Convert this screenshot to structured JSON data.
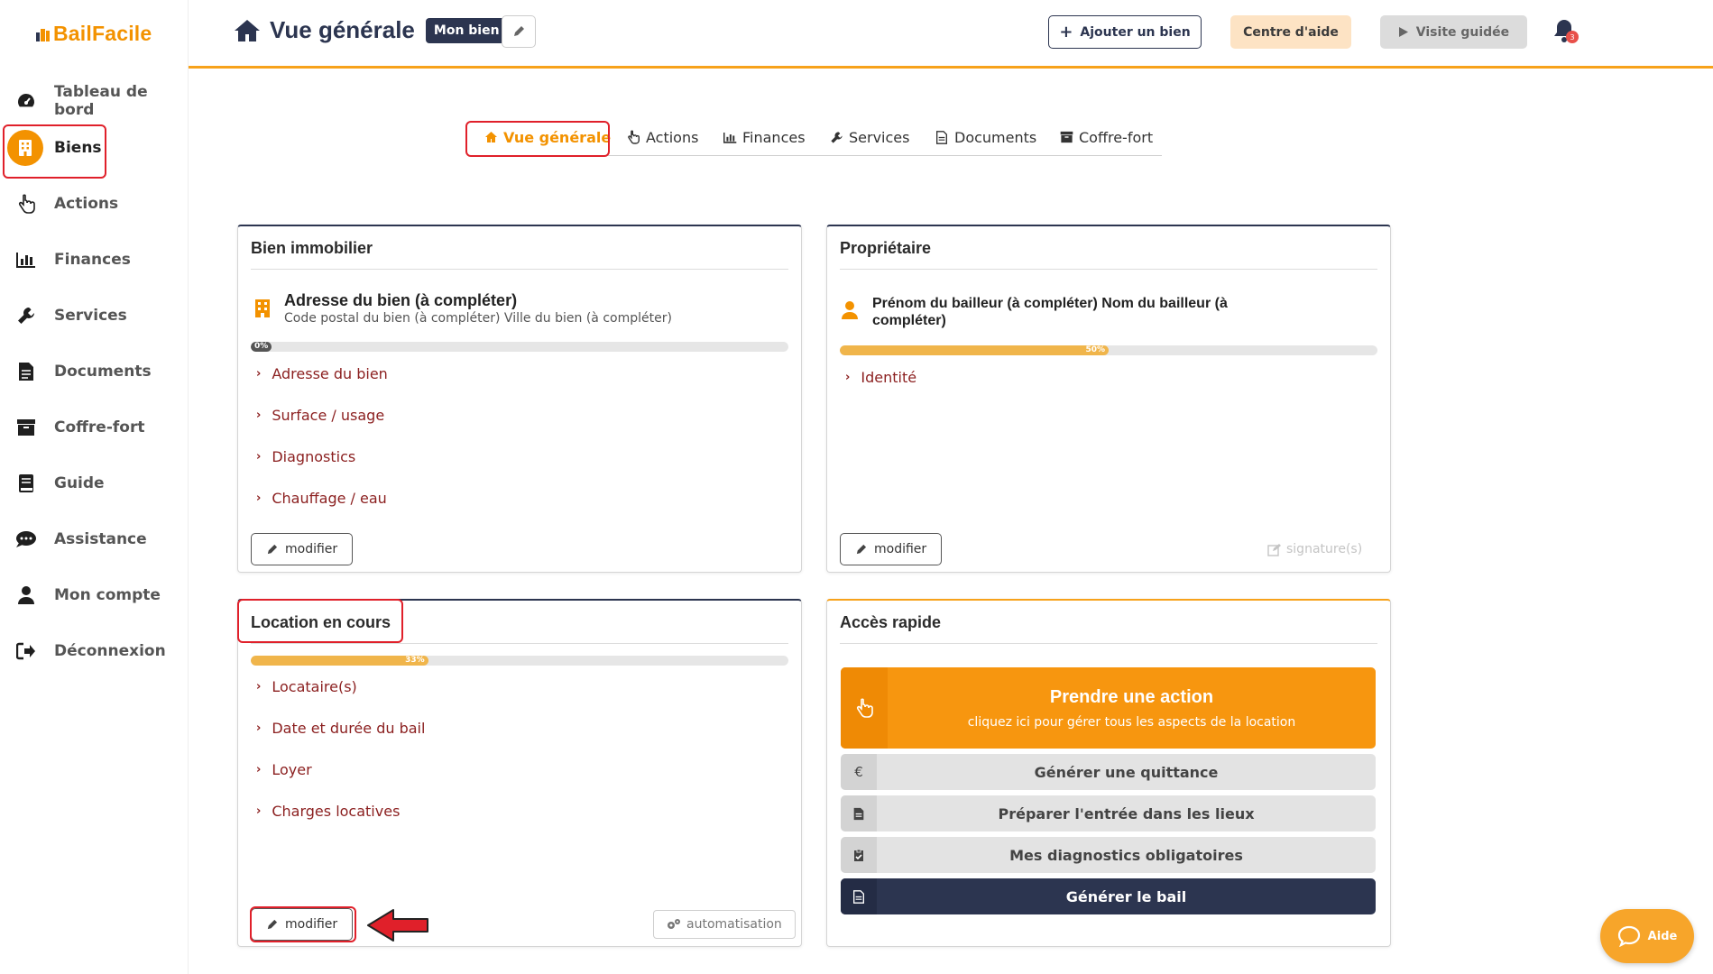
{
  "brand": {
    "name": "BailFacile",
    "color": "#f39200"
  },
  "sidebar": {
    "items": [
      {
        "label": "Tableau de bord",
        "icon": "gauge-icon"
      },
      {
        "label": "Biens",
        "icon": "building-icon",
        "active": true
      },
      {
        "label": "Actions",
        "icon": "hand-pointer-icon"
      },
      {
        "label": "Finances",
        "icon": "chart-icon"
      },
      {
        "label": "Services",
        "icon": "wrench-icon"
      },
      {
        "label": "Documents",
        "icon": "document-icon"
      },
      {
        "label": "Coffre-fort",
        "icon": "archive-icon"
      },
      {
        "label": "Guide",
        "icon": "book-icon"
      },
      {
        "label": "Assistance",
        "icon": "chat-icon"
      },
      {
        "label": "Mon compte",
        "icon": "user-icon"
      },
      {
        "label": "Déconnexion",
        "icon": "logout-icon"
      }
    ]
  },
  "header": {
    "title": "Vue générale",
    "badge": "Mon bien",
    "add_label": "Ajouter un bien",
    "help_label": "Centre d'aide",
    "tour_label": "Visite guidée",
    "notifications": "3"
  },
  "tabs": [
    {
      "label": "Vue générale",
      "active": true
    },
    {
      "label": "Actions"
    },
    {
      "label": "Finances"
    },
    {
      "label": "Services"
    },
    {
      "label": "Documents"
    },
    {
      "label": "Coffre-fort"
    }
  ],
  "property_card": {
    "title": "Bien immobilier",
    "address": "Adresse du bien (à compléter)",
    "subaddress": "Code postal du bien (à compléter) Ville du bien (à compléter)",
    "progress": 0,
    "progress_label": "0%",
    "links": [
      "Adresse du bien",
      "Surface / usage",
      "Diagnostics",
      "Chauffage / eau"
    ],
    "modify_label": "modifier"
  },
  "owner_card": {
    "title": "Propriétaire",
    "name": "Prénom du bailleur (à compléter) Nom du bailleur (à compléter)",
    "progress": 50,
    "progress_label": "50%",
    "links": [
      "Identité"
    ],
    "modify_label": "modifier",
    "signature_label": "signature(s)"
  },
  "rental_card": {
    "title": "Location en cours",
    "progress": 33,
    "progress_label": "33%",
    "links": [
      "Locataire(s)",
      "Date et durée du bail",
      "Loyer",
      "Charges locatives"
    ],
    "modify_label": "modifier",
    "automation_label": "automatisation"
  },
  "quick_access": {
    "title": "Accès rapide",
    "main_action": {
      "title": "Prendre une action",
      "subtitle": "cliquez ici pour gérer tous les aspects de la location"
    },
    "buttons": [
      {
        "label": "Générer une quittance",
        "icon": "€"
      },
      {
        "label": "Préparer l'entrée dans les lieux",
        "icon": "document-icon"
      },
      {
        "label": "Mes diagnostics obligatoires",
        "icon": "clipboard-icon"
      },
      {
        "label": "Générer le bail",
        "icon": "document-icon"
      }
    ]
  },
  "help_widget": {
    "label": "Aide"
  },
  "colors": {
    "accent": "#f39200",
    "navy": "#2c3550",
    "link": "#8b1f1f",
    "highlight": "#e0202a"
  }
}
